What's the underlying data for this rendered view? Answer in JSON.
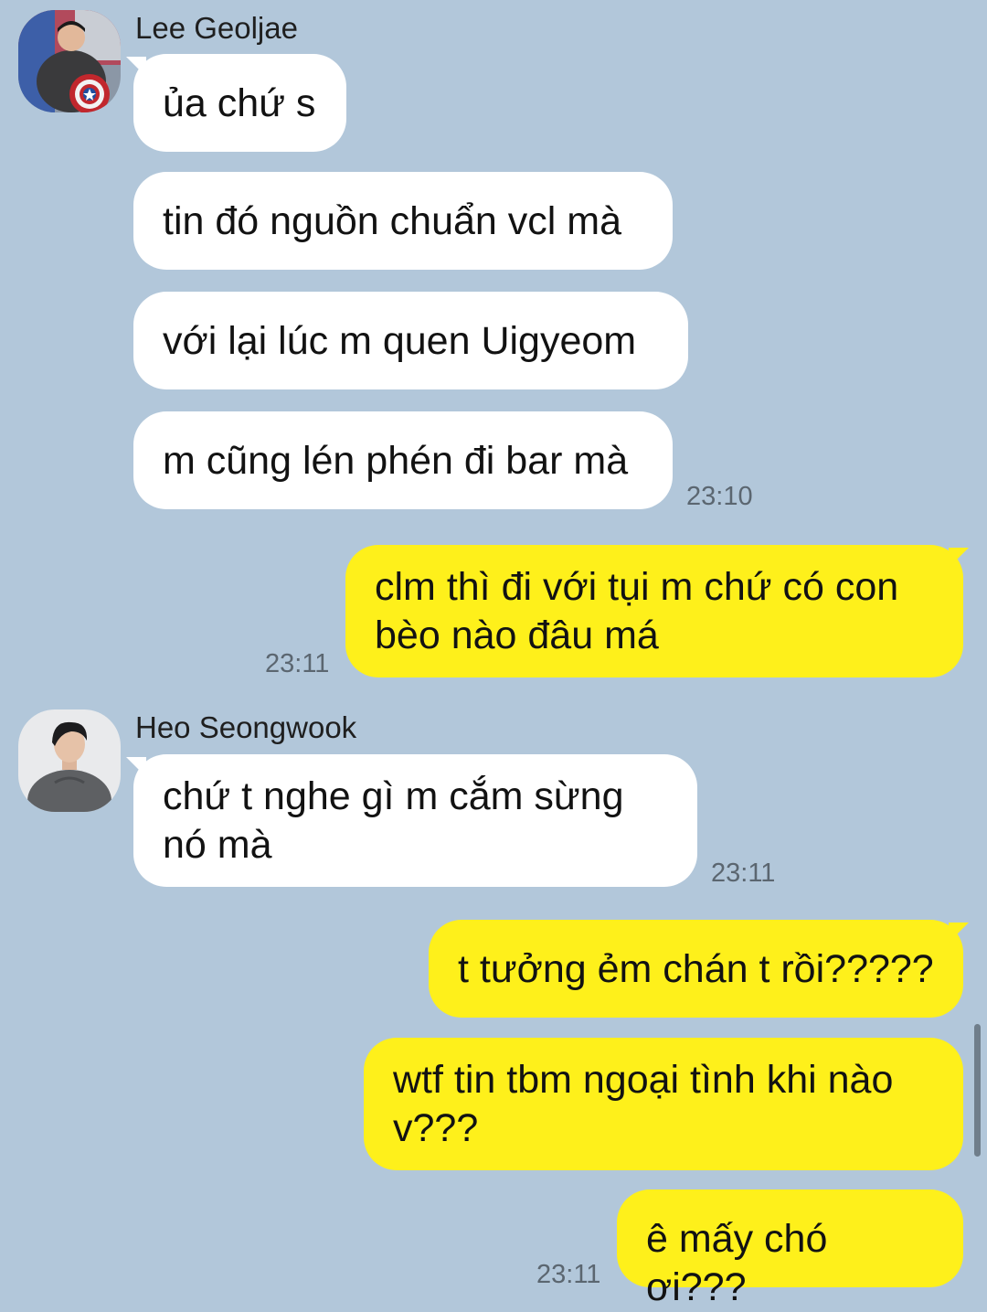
{
  "chat": {
    "group1": {
      "sender": "Lee Geoljae",
      "avatar_icon": "profile-photo-icon",
      "messages": [
        "ủa chứ s",
        "tin đó nguồn chuẩn vcl mà",
        "với lại lúc m quen Uigyeom",
        "m cũng lén phén đi bar mà"
      ],
      "time": "23:10"
    },
    "out1": {
      "message": "clm thì đi với tụi m chứ có con bèo nào đâu má",
      "time": "23:11"
    },
    "group2": {
      "sender": "Heo Seongwook",
      "avatar_icon": "profile-photo-icon",
      "messages": [
        "chứ t nghe gì m cắm sừng nó mà"
      ],
      "time": "23:11"
    },
    "out2": {
      "messages": [
        "t tưởng ẻm chán t rồi?????",
        "wtf tin tbm ngoại tình khi nào v???",
        "ê mấy chó ơi???"
      ],
      "time": "23:11"
    }
  },
  "colors": {
    "background": "#b2c7da",
    "incoming_bubble": "#ffffff",
    "outgoing_bubble": "#fef01b"
  }
}
